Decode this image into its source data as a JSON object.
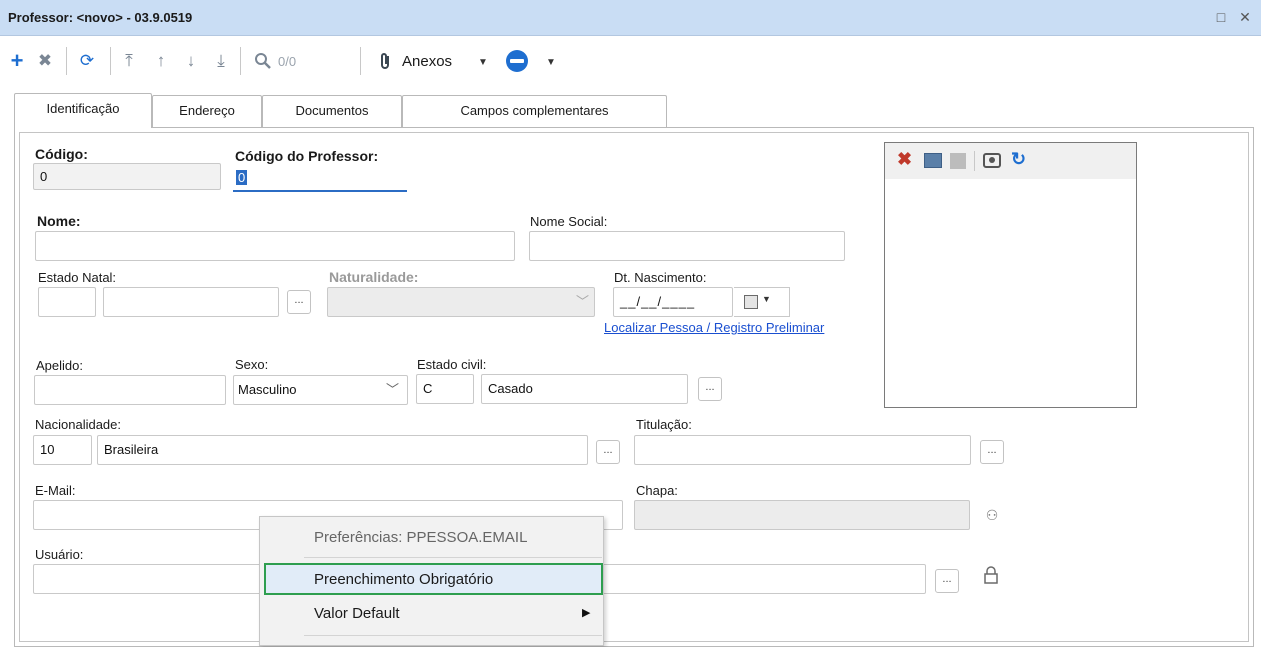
{
  "window": {
    "title": "Professor: <novo> - 03.9.0519",
    "maximize_icon": "□",
    "close_icon": "✕"
  },
  "toolbar": {
    "page_counter": "0/0",
    "attachments_label": "Anexos"
  },
  "tabs": [
    {
      "label": "Identificação"
    },
    {
      "label": "Endereço"
    },
    {
      "label": "Documentos"
    },
    {
      "label": "Campos complementares"
    }
  ],
  "form": {
    "codigo": {
      "label": "Código:",
      "value": "0"
    },
    "codigo_professor": {
      "label": "Código do Professor:",
      "value": "0"
    },
    "nome": {
      "label": "Nome:",
      "value": ""
    },
    "nome_social": {
      "label": "Nome Social:",
      "value": ""
    },
    "estado_natal": {
      "label": "Estado Natal:"
    },
    "naturalidade": {
      "label": "Naturalidade:"
    },
    "dt_nascimento": {
      "label": "Dt. Nascimento:",
      "value": "__/__/____"
    },
    "localizar_link": "Localizar Pessoa / Registro Preliminar",
    "apelido": {
      "label": "Apelido:",
      "value": ""
    },
    "sexo": {
      "label": "Sexo:",
      "value": "Masculino"
    },
    "estado_civil": {
      "label": "Estado civil:",
      "code": "C",
      "value": "Casado"
    },
    "nacionalidade": {
      "label": "Nacionalidade:",
      "code": "10",
      "value": "Brasileira"
    },
    "titulacao": {
      "label": "Titulação:",
      "value": ""
    },
    "email": {
      "label": "E-Mail:",
      "value": ""
    },
    "chapa": {
      "label": "Chapa:",
      "value": ""
    },
    "usuario": {
      "label": "Usuário:",
      "value": ""
    },
    "ellipsis": "..."
  },
  "context_menu": {
    "header": "Preferências: PPESSOA.EMAIL",
    "items": [
      {
        "label": "Preenchimento Obrigatório"
      },
      {
        "label": "Valor Default"
      }
    ]
  },
  "colors": {
    "accent_blue": "#2b6cc4",
    "title_bar": "#c9ddf4",
    "highlight_green": "#2e9e4f",
    "delete_red": "#c0392b"
  }
}
